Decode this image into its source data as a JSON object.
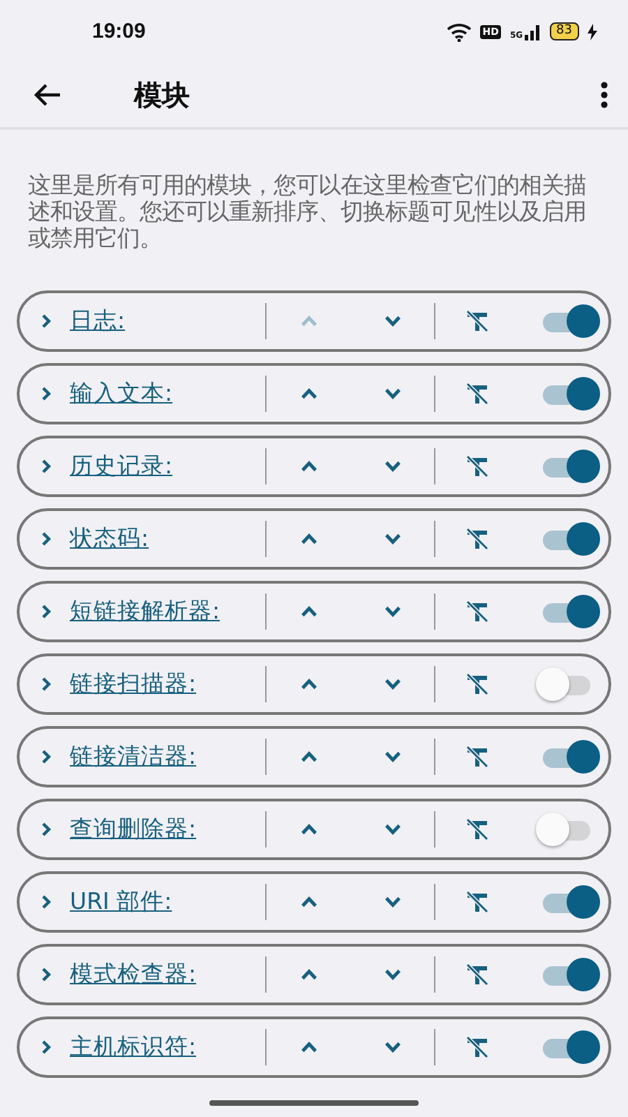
{
  "status_bar": {
    "time": "19:09",
    "hd": "HD",
    "network": "5G",
    "battery": "83"
  },
  "app_bar": {
    "title": "模块"
  },
  "description": "这里是所有可用的模块，您可以在这里检查它们的相关描述和设置。您还可以重新排序、切换标题可见性以及启用或禁用它们。",
  "modules": [
    {
      "label": "日志:",
      "expanded": false,
      "up_disabled": true,
      "enabled": true
    },
    {
      "label": "输入文本:",
      "expanded": false,
      "up_disabled": false,
      "enabled": true
    },
    {
      "label": "历史记录:",
      "expanded": false,
      "up_disabled": false,
      "enabled": true
    },
    {
      "label": "状态码:",
      "expanded": false,
      "up_disabled": false,
      "enabled": true
    },
    {
      "label": "短链接解析器:",
      "expanded": false,
      "up_disabled": false,
      "enabled": true
    },
    {
      "label": "链接扫描器:",
      "expanded": false,
      "up_disabled": false,
      "enabled": false
    },
    {
      "label": "链接清洁器:",
      "expanded": false,
      "up_disabled": false,
      "enabled": true
    },
    {
      "label": "查询删除器:",
      "expanded": false,
      "up_disabled": false,
      "enabled": false
    },
    {
      "label": "URI 部件:",
      "expanded": false,
      "up_disabled": false,
      "enabled": true
    },
    {
      "label": "模式检查器:",
      "expanded": false,
      "up_disabled": false,
      "enabled": true
    },
    {
      "label": "主机标识符:",
      "expanded": false,
      "up_disabled": false,
      "enabled": true
    }
  ]
}
